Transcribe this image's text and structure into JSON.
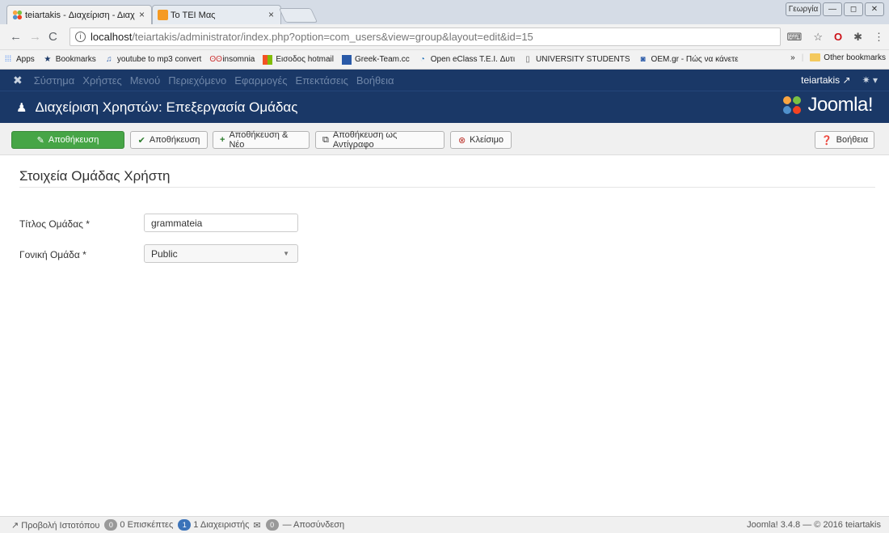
{
  "browser": {
    "tabs": [
      {
        "title": "teiartakis - Διαχείριση - Διαχ",
        "close": "×"
      },
      {
        "title": "Το ΤΕΙ Μας",
        "close": "×"
      }
    ],
    "window_user": "Γεωργία",
    "window_buttons": [
      "—",
      "◻",
      "✕"
    ],
    "url_host": "localhost",
    "url_rest": "/teiartakis/administrator/index.php?option=com_users&view=group&layout=edit&id=15",
    "bookmarks": [
      {
        "label": "Apps",
        "icon": "apps-icon"
      },
      {
        "label": "Bookmarks",
        "icon": "star-icon"
      },
      {
        "label": "youtube to mp3 convert",
        "icon": "music-icon"
      },
      {
        "label": "insomnia",
        "icon": "eyes-icon"
      },
      {
        "label": "Εισοδος hotmail",
        "icon": "windows-icon"
      },
      {
        "label": "Greek-Team.cc",
        "icon": "film-icon"
      },
      {
        "label": "Open eClass T.E.I. Δυτι",
        "icon": "eclass-icon"
      },
      {
        "label": "UNIVERSITY STUDENTS",
        "icon": "page-icon"
      },
      {
        "label": "OEM.gr - Πώς να κάνετε",
        "icon": "oem-icon"
      }
    ],
    "bookmarks_more": "»",
    "other_bookmarks": "Other bookmarks"
  },
  "jnav": {
    "menu": [
      "Σύστημα",
      "Χρήστες",
      "Μενού",
      "Περιεχόμενο",
      "Εφαρμογές",
      "Επεκτάσεις",
      "Βοήθεια"
    ],
    "user": "teiartakis",
    "brand": "Joomla!"
  },
  "title": "Διαχείριση Χρηστών: Επεξεργασία Ομάδας",
  "toolbar": {
    "save": "Αποθήκευση",
    "save_close": "Αποθήκευση",
    "save_new": "Αποθήκευση & Νέο",
    "save_copy": "Αποθήκευση ως Αντίγραφο",
    "close": "Κλείσιμο",
    "help": "Βοήθεια"
  },
  "form": {
    "section": "Στοιχεία Ομάδας Χρήστη",
    "title_label": "Τίτλος Ομάδας *",
    "title_value": "grammateia",
    "parent_label": "Γονική Ομάδα *",
    "parent_value": "Public"
  },
  "status": {
    "view_site": "Προβολή Ιστοτόπου",
    "visitors_count": "0",
    "visitors_label": "0 Επισκέπτες",
    "admins_count": "1",
    "admins_label": "1 Διαχειριστής",
    "messages_count": "0",
    "logout": "Αποσύνδεση",
    "version": "Joomla! 3.4.8 — © 2016 teiartakis"
  },
  "colors": {
    "nav_bg": "#1a3867",
    "save_green": "#46a546",
    "joomla_orange": "#f9a541"
  }
}
